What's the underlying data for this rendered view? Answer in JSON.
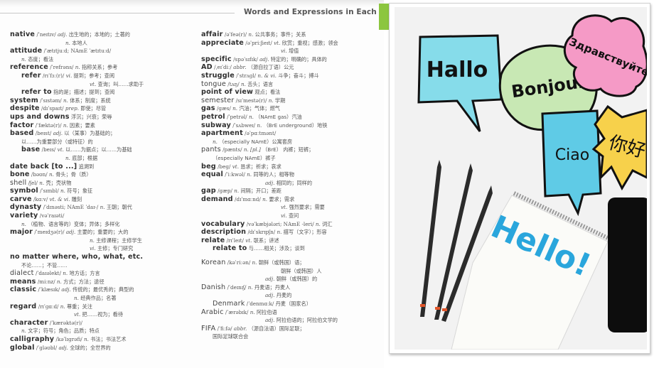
{
  "header": {
    "title": "Words and Expressions in Each"
  },
  "accent_color": "#8cc63f",
  "left_column": [
    {
      "hw": "native",
      "ph": "/ˈneɪtɪv/",
      "pos": "adj.",
      "def": "出生地的；本地的；土著的"
    },
    {
      "indent": "ind3",
      "pos": "n.",
      "def": "本地人"
    },
    {
      "hw": "attitude",
      "ph": "/ˈætɪtjuːd; NAmE ˈætɪtuːd/"
    },
    {
      "indent": "ind1",
      "pos": "n.",
      "def": "态度；看法"
    },
    {
      "hw": "reference",
      "ph": "/ˈrefrəns/",
      "pos": "n.",
      "def": "指称关系；参考"
    },
    {
      "indent": "ind1",
      "hw": "refer",
      "ph": "/rɪˈfɜː(r)/",
      "pos": "vi.",
      "def": "提到；参考；查阅"
    },
    {
      "indent": "ind4",
      "pos": "vt.",
      "def": "查询；叫……求助于"
    },
    {
      "indent": "ind1",
      "hw": "refer to",
      "def": "指的是；描述；提到；查阅"
    },
    {
      "hw": "system",
      "ph": "/ˈsɪstəm/",
      "pos": "n.",
      "def": "体系；制度；系统"
    },
    {
      "hw": "despite",
      "ph": "/dɪˈspaɪt/",
      "pos": "prep.",
      "def": "即使；尽管"
    },
    {
      "hw": "ups and downs",
      "def": "浮沉；兴衰；荣辱"
    },
    {
      "hw": "factor",
      "ph": "/ˈfæktə(r)/",
      "pos": "n.",
      "def": "因素；要素"
    },
    {
      "hw": "based",
      "ph": "/beɪst/",
      "pos": "adj.",
      "def": "以（某事）为基础的；"
    },
    {
      "indent": "ind1",
      "def": "以……为重要部分（或特征）的"
    },
    {
      "indent": "ind1",
      "hw": "base",
      "ph": "/beɪs/",
      "pos": "vt.",
      "def": "以……为据点；以……为基础"
    },
    {
      "indent": "ind3",
      "pos": "n.",
      "def": "底部；根据"
    },
    {
      "hw": "date back [to ...]",
      "def": "追溯到"
    },
    {
      "hw": "bone",
      "ph": "/bəʊn/",
      "pos": "n.",
      "def": "骨头；骨（质）"
    },
    {
      "hw": "shell",
      "ph": "/ʃel/",
      "pos": "n.",
      "def": "壳；壳状物",
      "light": true
    },
    {
      "hw": "symbol",
      "ph": "/ˈsɪmbl/",
      "pos": "n.",
      "def": "符号；象征"
    },
    {
      "hw": "carve",
      "ph": "/kɑːv/",
      "pos": "vt. & vi.",
      "def": "雕刻"
    },
    {
      "hw": "dynasty",
      "ph": "/ˈdɪnəsti; NAmE ˈdaɪ-/",
      "pos": "n.",
      "def": "王朝；朝代"
    },
    {
      "hw": "variety",
      "ph": "/vəˈraɪəti/"
    },
    {
      "indent": "ind1",
      "pos": "n.",
      "def": "（植物、语言等的）变体；异体；多样化"
    },
    {
      "hw": "major",
      "ph": "/ˈmeɪdʒə(r)/",
      "pos": "adj.",
      "def": "主要的；重要的；大的"
    },
    {
      "indent": "ind4",
      "pos": "n.",
      "def": "主修课程；主修学生"
    },
    {
      "indent": "ind4",
      "pos": "vi.",
      "def": "主修；专门研究"
    },
    {
      "hw": "no matter where, who, what, etc."
    },
    {
      "indent": "ind1",
      "def": "不论……；不管……"
    },
    {
      "hw": "dialect",
      "ph": "/ˈdaɪəlekt/",
      "pos": "n.",
      "def": "地方话；方言",
      "light": true
    },
    {
      "hw": "means",
      "ph": "/miːnz/",
      "pos": "n.",
      "def": "方式；方法；途径"
    },
    {
      "hw": "classic",
      "ph": "/ˈklæsɪk/",
      "pos": "adj.",
      "def": "传统的；最优秀的；典型的"
    },
    {
      "indent": "ind5",
      "pos": "n.",
      "def": "经典作品；名著"
    },
    {
      "hw": "regard",
      "ph": "/rɪˈɡɑːd/",
      "pos": "n.",
      "def": "尊重；关注"
    },
    {
      "indent": "ind5",
      "pos": "vt.",
      "def": "把……视为；看待"
    },
    {
      "hw": "character",
      "ph": "/ˈkærəktə(r)/"
    },
    {
      "indent": "ind1",
      "pos": "n.",
      "def": "文字；符号；角色；品质；特点"
    },
    {
      "hw": "calligraphy",
      "ph": "/kəˈlɪɡrəfi/",
      "pos": "n.",
      "def": "书法；书法艺术"
    },
    {
      "hw": "global",
      "ph": "/ˈɡləʊbl/",
      "pos": "adj.",
      "def": "全球的；全世界的"
    }
  ],
  "right_column": [
    {
      "hw": "affair",
      "ph": "/əˈfeə(r)/",
      "pos": "n.",
      "def": "公共事务；事件；关系"
    },
    {
      "hw": "appreciate",
      "ph": "/əˈpriːʃieɪt/",
      "pos": "vt.",
      "def": "欣赏；重视；感激；领会"
    },
    {
      "indent": "ind4",
      "pos": "vi.",
      "def": "增值"
    },
    {
      "hw": "specific",
      "ph": "/spəˈsɪfɪk/",
      "pos": "adj.",
      "def": "特定的；明确的；具体的"
    },
    {
      "hw": "AD",
      "ph": "/ˌeɪˈdiː/",
      "pos": "abbr.",
      "def": "（源自拉丁语）公元"
    },
    {
      "hw": "struggle",
      "ph": "/ˈstrʌɡl/",
      "pos": "n. & vi.",
      "def": "斗争；奋斗；搏斗"
    },
    {
      "hw": "tongue",
      "ph": "/tʌŋ/",
      "pos": "n.",
      "def": "舌头；语言",
      "light": true
    },
    {
      "hw": "point of view",
      "def": "观点；看法"
    },
    {
      "hw": "semester",
      "ph": "/sɪˈmestə(r)/",
      "pos": "n.",
      "def": "学期",
      "light": true
    },
    {
      "hw": "gas",
      "ph": "/ɡæs/",
      "pos": "n.",
      "def": "汽油；气体；燃气"
    },
    {
      "hw": "petrol",
      "ph": "/ˈpetrəl/",
      "pos": "n.",
      "def": "（NAmE gas）汽油"
    },
    {
      "hw": "subway",
      "ph": "/ˈsʌbweɪ/",
      "pos": "n.",
      "def": "（BrE underground）地铁"
    },
    {
      "hw": "apartment",
      "ph": "/əˈpɑːtmənt/"
    },
    {
      "indent": "ind1",
      "pos": "n.",
      "def": "（especially NAmE）公寓套房"
    },
    {
      "hw": "pants",
      "ph": "/pænts/",
      "pos": "n. [pl.]",
      "def": "（BrE） 内裤；短裤；",
      "light": true
    },
    {
      "indent": "ind1",
      "def": "（especially NAmE）裤子"
    },
    {
      "hw": "beg",
      "ph": "/beɡ/",
      "pos": "vt.",
      "def": "恳求；祈求；哀求"
    },
    {
      "hw": "equal",
      "ph": "/ˈiːkwəl/",
      "pos": "n.",
      "def": "同等的人；相等物"
    },
    {
      "indent": "ind5",
      "pos": "adj.",
      "def": "相同的；同样的"
    },
    {
      "hw": "gap",
      "ph": "/ɡæp/",
      "pos": "n.",
      "def": "间隔；开口；差距"
    },
    {
      "hw": "demand",
      "ph": "/dɪˈmɑːnd/",
      "pos": "n.",
      "def": "要求；需求"
    },
    {
      "indent": "ind4",
      "pos": "vt.",
      "def": "强烈要求；需要"
    },
    {
      "indent": "ind4",
      "pos": "vi.",
      "def": "查问"
    },
    {
      "hw": "vocabulary",
      "ph": "/vəˈkæbjələri; NAmE -leri/",
      "pos": "n.",
      "def": "词汇"
    },
    {
      "hw": "description",
      "ph": "/dɪˈskrɪpʃn/",
      "pos": "n.",
      "def": "描写（文字）；形容"
    },
    {
      "hw": "relate",
      "ph": "/rɪˈleɪt/",
      "pos": "vt.",
      "def": "联系；讲述"
    },
    {
      "indent": "ind1",
      "hw": "relate to",
      "def": "与……相关；涉及；谈到"
    },
    {
      "gap": true
    },
    {
      "hw": "Korean",
      "ph": "/kəˈriːən/",
      "pos": "n.",
      "def": "朝鲜（或韩国）语；",
      "light": true
    },
    {
      "indent": "ind4",
      "def": "朝鲜（或韩国）人"
    },
    {
      "indent": "ind5",
      "pos": "adj.",
      "def": "朝鲜（或韩国）的"
    },
    {
      "hw": "Danish",
      "ph": "/ˈdeɪnɪʃ/",
      "pos": "n.",
      "def": "丹麦语；丹麦人",
      "light": true
    },
    {
      "indent": "ind5",
      "pos": "adj.",
      "def": "丹麦的"
    },
    {
      "indent": "ind1",
      "hw": "Denmark",
      "ph": "/ˈdenmɑːk/",
      "def": "丹麦（国家名）",
      "light": true
    },
    {
      "hw": "Arabic",
      "ph": "/ˈærəbɪk/",
      "pos": "n.",
      "def": "阿拉伯语",
      "light": true
    },
    {
      "indent": "ind5",
      "pos": "adj.",
      "def": "阿拉伯语的；阿拉伯文学的"
    },
    {
      "hw": "FIFA",
      "ph": "/ˈfiːfə/",
      "pos": "abbr.",
      "def": "（源自法语）国际足联；",
      "light": true
    },
    {
      "indent": "ind1",
      "def": "国际足球联合会"
    }
  ],
  "photo": {
    "bubbles": [
      {
        "text": "Hallo",
        "color": "#7fdbe8"
      },
      {
        "text": "Bonjour",
        "color": "#c7e8b4"
      },
      {
        "text": "Здравствуйте",
        "color": "#f59ac6"
      },
      {
        "text": "Ciao",
        "color": "#5fcbe6"
      },
      {
        "text": "你好",
        "color": "#f7d14b"
      }
    ],
    "notepad_text": "Hello!",
    "notepad_text_color": "#2aa6dc"
  }
}
